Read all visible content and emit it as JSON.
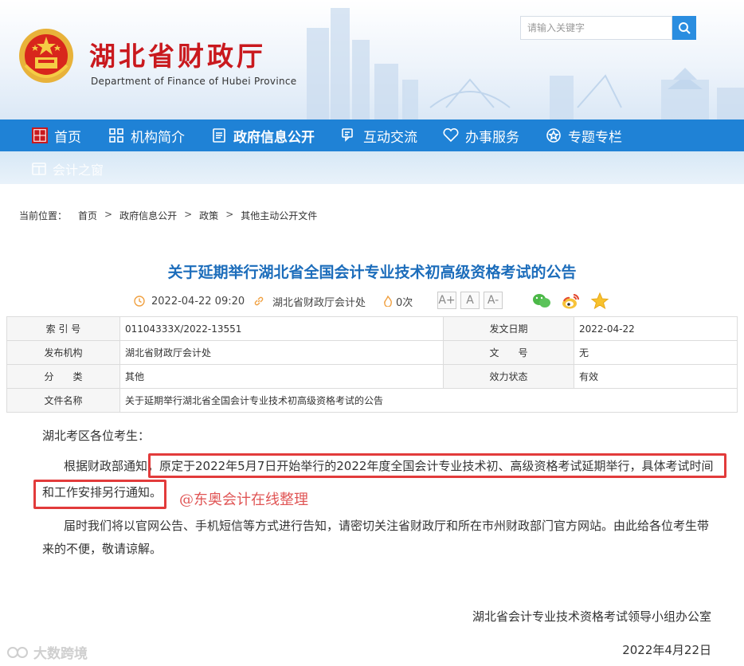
{
  "header": {
    "title": "湖北省财政厅",
    "subtitle": "Department of Finance of Hubei Province",
    "search_placeholder": "请输入关键字"
  },
  "nav": {
    "items": [
      {
        "label": "首页",
        "icon": "hubei-finance-logo-icon"
      },
      {
        "label": "机构简介",
        "icon": "grid-icon"
      },
      {
        "label": "政府信息公开",
        "icon": "document-icon"
      },
      {
        "label": "互动交流",
        "icon": "chat-icon"
      },
      {
        "label": "办事服务",
        "icon": "heart-icon"
      },
      {
        "label": "专题专栏",
        "icon": "star-circle-icon"
      }
    ],
    "second_row": [
      {
        "label": "会计之窗",
        "icon": "window-icon"
      }
    ]
  },
  "breadcrumb": {
    "prefix": "当前位置：",
    "items": [
      "首页",
      "政府信息公开",
      "政策",
      "其他主动公开文件"
    ],
    "separator": ">"
  },
  "article": {
    "title": "关于延期举行湖北省全国会计专业技术初高级资格考试的公告",
    "date": "2022-04-22 09:20",
    "source": "湖北省财政厅会计处",
    "views": "0次",
    "font_buttons": [
      "A+",
      "A",
      "A-"
    ],
    "share_icons": [
      "wechat-icon",
      "weibo-icon",
      "favorite-star-icon"
    ]
  },
  "info_table": {
    "rows": [
      {
        "k1": "索 引 号",
        "v1": "01104333X/2022-13551",
        "k2": "发文日期",
        "v2": "2022-04-22"
      },
      {
        "k1": "发布机构",
        "v1": "湖北省财政厅会计处",
        "k2": "文　　号",
        "v2": "无"
      },
      {
        "k1": "分　　类",
        "v1": "其他",
        "k2": "效力状态",
        "v2": "有效"
      },
      {
        "k1": "文件名称",
        "v1": "关于延期举行湖北省全国会计专业技术初高级资格考试的公告",
        "k2": "",
        "v2": ""
      }
    ]
  },
  "body": {
    "salutation": "湖北考区各位考生：",
    "p1_line1": "根据财政部通知，原定于2022年5月7日开始举行的2022年度全国会计专业技术初、高级资格考试延期举行，具体考试时间",
    "p1_line2": "和工作安排另行通知。",
    "p2_line1": "届时我们将以官网公告、手机短信等方式进行告知，请密切关注省财政厅和所在市州财政部门官方网站。由此给各位考生带",
    "p2_line2": "来的不便，敬请谅解。",
    "signature": "湖北省会计专业技术资格考试领导小组办公室",
    "sign_date": "2022年4月22日"
  },
  "overlays": {
    "annotation": "@东奥会计在线整理",
    "corner_watermark": "大数跨境"
  },
  "colors": {
    "brand_red": "#c9191e",
    "nav_blue": "#1f82d6",
    "title_blue": "#1c6dbb",
    "highlight_red": "#e23b3b"
  }
}
